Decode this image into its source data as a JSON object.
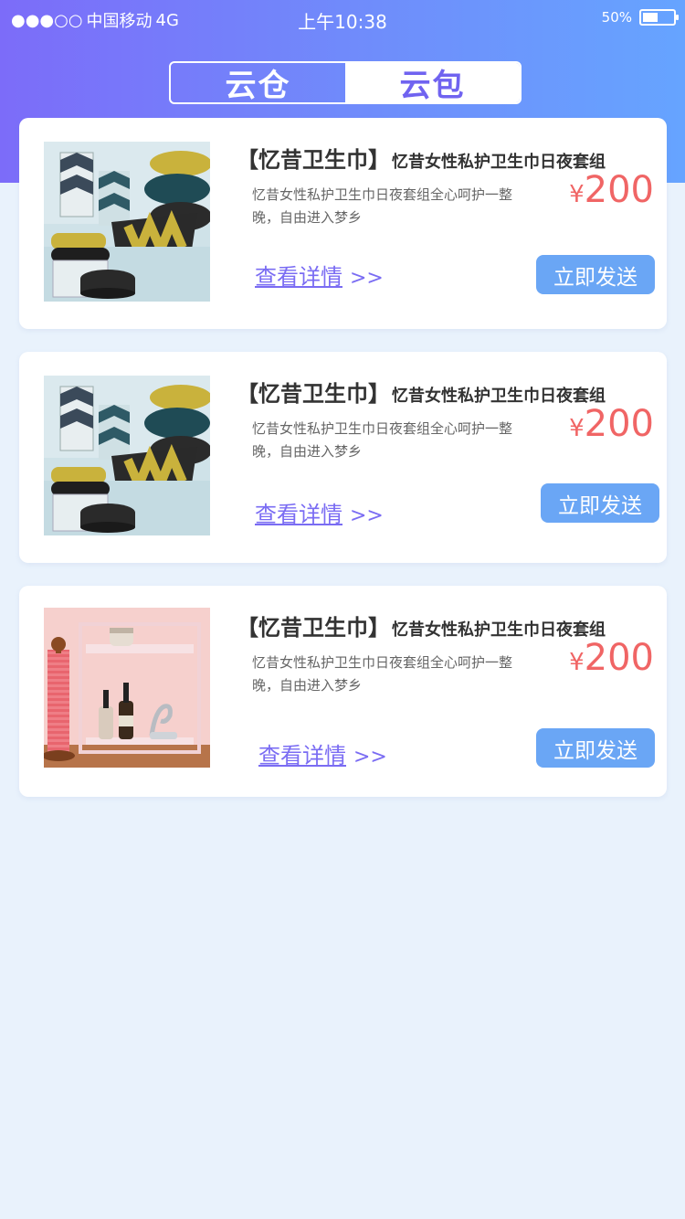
{
  "status_bar": {
    "signal": "●●●○○",
    "carrier": "中国移动",
    "network": "4G",
    "time": "上午10:38",
    "battery_percent": "50%",
    "battery_level": 0.5
  },
  "segment": {
    "tabs": [
      {
        "label": "云仓",
        "active": true
      },
      {
        "label": "云包",
        "active": false
      }
    ]
  },
  "colors": {
    "header_gradient": [
      "#7c6cf9",
      "#66a4ff"
    ],
    "price": "#f06565",
    "link": "#7a6cf3",
    "button": "#6aa6f5",
    "page_bg": "#e9f2fc"
  },
  "products": [
    {
      "image": "pillows-photo",
      "brand": "【忆昔卫生巾】",
      "name": "忆昔女性私护卫生巾日夜套组",
      "description": "忆昔女性私护卫生巾日夜套组全心呵护一整晚，自由进入梦乡",
      "currency": "¥",
      "price": "200",
      "detail_label": "查看详情",
      "detail_arrows": ">>",
      "send_label": "立即发送"
    },
    {
      "image": "pillows-photo",
      "brand": "【忆昔卫生巾】",
      "name": "忆昔女性私护卫生巾日夜套组",
      "description": "忆昔女性私护卫生巾日夜套组全心呵护一整晚，自由进入梦乡",
      "currency": "¥",
      "price": "200",
      "detail_label": "查看详情",
      "detail_arrows": ">>",
      "send_label": "立即发送"
    },
    {
      "image": "shelf-photo",
      "brand": "【忆昔卫生巾】",
      "name": "忆昔女性私护卫生巾日夜套组",
      "description": "忆昔女性私护卫生巾日夜套组全心呵护一整晚，自由进入梦乡",
      "currency": "¥",
      "price": "200",
      "detail_label": "查看详情",
      "detail_arrows": ">>",
      "send_label": "立即发送"
    }
  ]
}
